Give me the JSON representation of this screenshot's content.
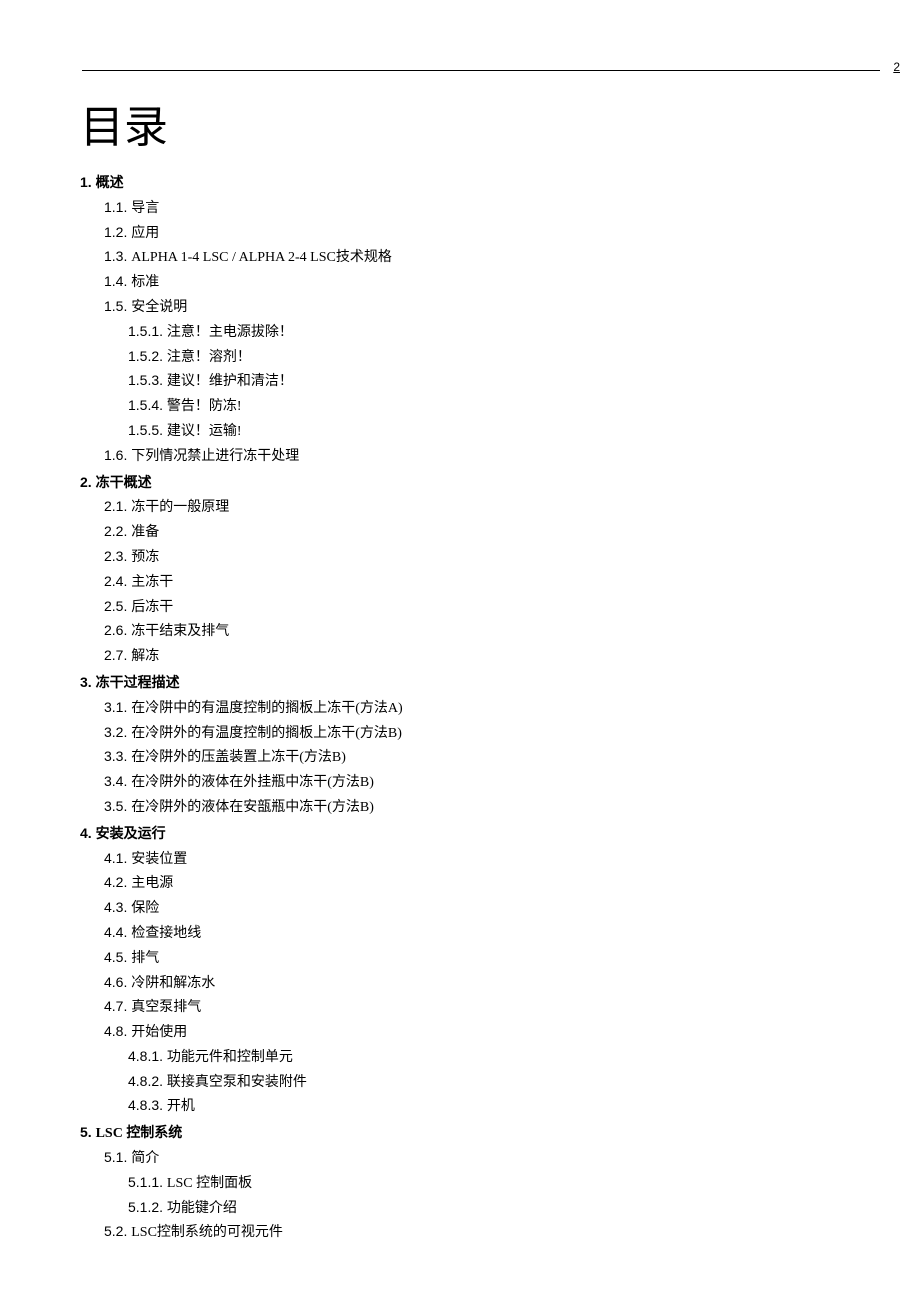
{
  "page_number": "2",
  "title": "目录",
  "toc": [
    {
      "lvl": 1,
      "num": "1.",
      "txt": "概述"
    },
    {
      "lvl": 2,
      "num": "1.1.",
      "txt": "导言"
    },
    {
      "lvl": 2,
      "num": "1.2.",
      "txt": "应用"
    },
    {
      "lvl": 2,
      "num": "1.3.",
      "txt": "ALPHA 1-4 LSC / ALPHA 2-4 LSC技术规格"
    },
    {
      "lvl": 2,
      "num": "1.4.",
      "txt": "标准"
    },
    {
      "lvl": 2,
      "num": "1.5.",
      "txt": "安全说明"
    },
    {
      "lvl": 3,
      "num": "1.5.1.",
      "txt": "注意！主电源拔除！"
    },
    {
      "lvl": 3,
      "num": "1.5.2.",
      "txt": "注意！溶剂！"
    },
    {
      "lvl": 3,
      "num": "1.5.3.",
      "txt": "建议！维护和清洁！"
    },
    {
      "lvl": 3,
      "num": "1.5.4.",
      "txt": "警告！防冻!"
    },
    {
      "lvl": 3,
      "num": "1.5.5.",
      "txt": "建议！运输!"
    },
    {
      "lvl": 2,
      "num": "1.6.",
      "txt": " 下列情况禁止进行冻干处理"
    },
    {
      "lvl": 1,
      "num": "2.",
      "txt": "冻干概述"
    },
    {
      "lvl": 2,
      "num": "2.1.",
      "txt": "冻干的一般原理"
    },
    {
      "lvl": 2,
      "num": "2.2.",
      "txt": "准备"
    },
    {
      "lvl": 2,
      "num": "2.3.",
      "txt": "预冻"
    },
    {
      "lvl": 2,
      "num": "2.4.",
      "txt": "主冻干"
    },
    {
      "lvl": 2,
      "num": "2.5.",
      "txt": "后冻干"
    },
    {
      "lvl": 2,
      "num": "2.6.",
      "txt": "冻干结束及排气"
    },
    {
      "lvl": 2,
      "num": "2.7.",
      "txt": "解冻"
    },
    {
      "lvl": 1,
      "num": "3.",
      "txt": "冻干过程描述"
    },
    {
      "lvl": 2,
      "num": "3.1.",
      "txt": "在冷阱中的有温度控制的搁板上冻干(方法A)"
    },
    {
      "lvl": 2,
      "num": "3.2.",
      "txt": "在冷阱外的有温度控制的搁板上冻干(方法B)"
    },
    {
      "lvl": 2,
      "num": "3.3.",
      "txt": "在冷阱外的压盖装置上冻干(方法B)"
    },
    {
      "lvl": 2,
      "num": "3.4.",
      "txt": "在冷阱外的液体在外挂瓶中冻干(方法B)"
    },
    {
      "lvl": 2,
      "num": "3.5.",
      "txt": "在冷阱外的液体在安瓿瓶中冻干(方法B)"
    },
    {
      "lvl": 1,
      "num": "4.",
      "txt": "安装及运行"
    },
    {
      "lvl": 2,
      "num": "4.1.",
      "txt": "安装位置"
    },
    {
      "lvl": 2,
      "num": "4.2.",
      "txt": "主电源"
    },
    {
      "lvl": 2,
      "num": "4.3.",
      "txt": "保险"
    },
    {
      "lvl": 2,
      "num": "4.4.",
      "txt": "检查接地线"
    },
    {
      "lvl": 2,
      "num": "4.5.",
      "txt": "排气"
    },
    {
      "lvl": 2,
      "num": "4.6.",
      "txt": "冷阱和解冻水"
    },
    {
      "lvl": 2,
      "num": "4.7.",
      "txt": "真空泵排气"
    },
    {
      "lvl": 2,
      "num": "4.8.",
      "txt": "开始使用"
    },
    {
      "lvl": 3,
      "num": "4.8.1.",
      "txt": "功能元件和控制单元"
    },
    {
      "lvl": 3,
      "num": "4.8.2.",
      "txt": "联接真空泵和安装附件"
    },
    {
      "lvl": 3,
      "num": "4.8.3.",
      "txt": "开机"
    },
    {
      "lvl": 1,
      "num": "5.",
      "txt": "LSC 控制系统"
    },
    {
      "lvl": 2,
      "num": "5.1.",
      "txt": "简介"
    },
    {
      "lvl": 3,
      "num": "5.1.1.",
      "txt": "LSC 控制面板"
    },
    {
      "lvl": 3,
      "num": "5.1.2.",
      "txt": "功能键介绍"
    },
    {
      "lvl": 2,
      "num": "5.2.",
      "txt": "LSC控制系统的可视元件"
    }
  ]
}
